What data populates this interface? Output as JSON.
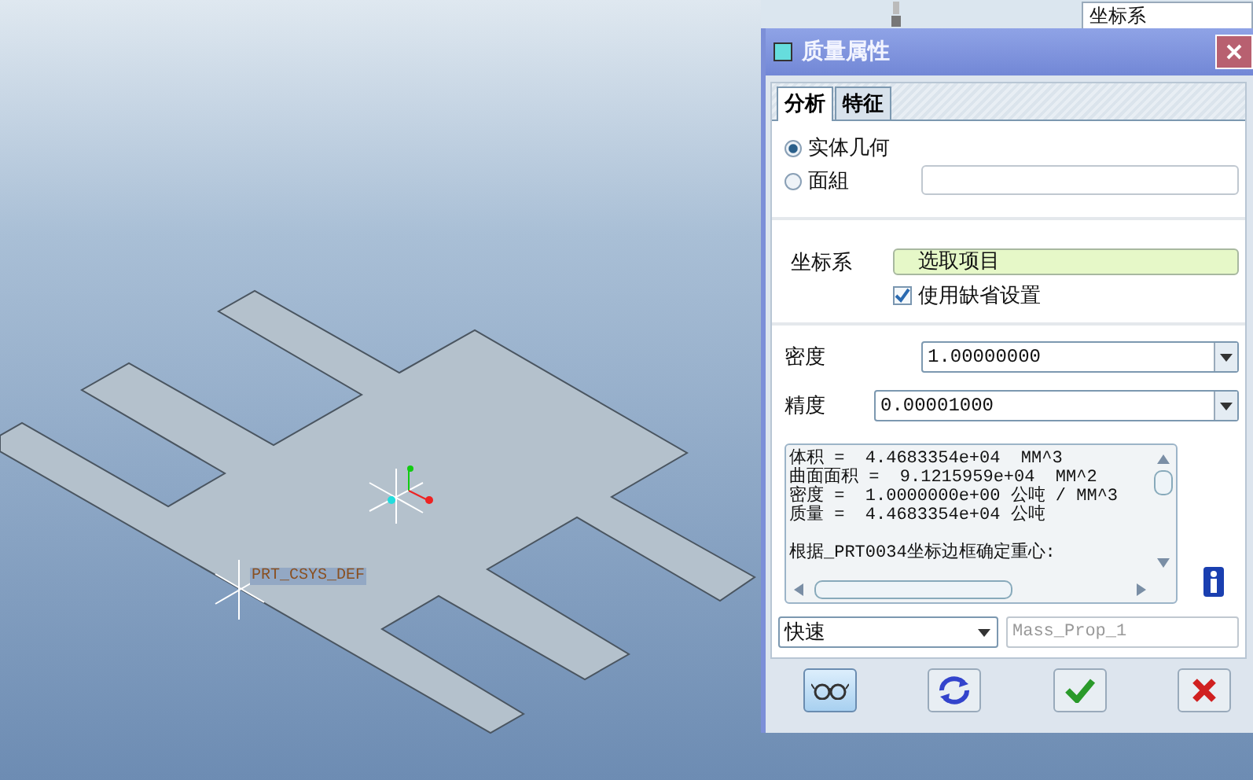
{
  "top_strip": {
    "field": "坐标系"
  },
  "viewport": {
    "csys_label": "PRT_CSYS_DEF"
  },
  "dialog": {
    "title": "质量属性",
    "tabs": [
      {
        "label": "分析",
        "selected": true
      },
      {
        "label": "特征",
        "selected": false
      }
    ],
    "geometry_options": [
      {
        "label": "实体几何",
        "selected": true
      },
      {
        "label": "面組",
        "selected": false
      }
    ],
    "coord_label": "坐标系",
    "coord_field": "选取项目",
    "use_default": {
      "label": "使用缺省设置",
      "checked": true
    },
    "density": {
      "label": "密度",
      "value": "1.00000000"
    },
    "precision": {
      "label": "精度",
      "value": "0.00001000"
    },
    "results": [
      {
        "text": "体积 =  4.4683354e+04  MM^3",
        "gap_before": false
      },
      {
        "text": "曲面面积 =  9.1215959e+04  MM^2",
        "gap_before": false
      },
      {
        "text": "密度 =  1.0000000e+00 公吨 / MM^3",
        "gap_before": false
      },
      {
        "text": "质量 =  4.4683354e+04 公吨",
        "gap_before": false
      },
      {
        "text": "根据_PRT0034坐标边框确定重心:",
        "gap_before": true
      }
    ],
    "mode": "快速",
    "name_placeholder": "Mass_Prop_1",
    "buttons": [
      {
        "kind": "preview",
        "selected": true
      },
      {
        "kind": "regenerate",
        "selected": false
      },
      {
        "kind": "ok",
        "selected": false
      },
      {
        "kind": "cancel",
        "selected": false
      }
    ]
  }
}
